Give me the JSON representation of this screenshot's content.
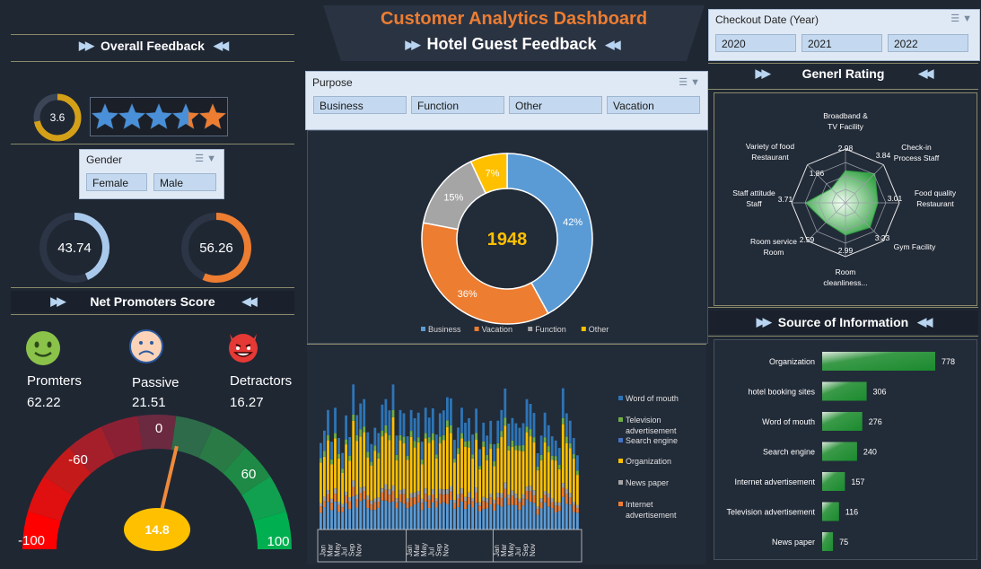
{
  "title": {
    "main": "Customer Analytics Dashboard",
    "sub": "Hotel Guest Feedback"
  },
  "overall_feedback": {
    "heading": "Overall Feedback",
    "rating": "3.6",
    "stars_filled": 3.6
  },
  "gender": {
    "title": "Gender",
    "options": [
      "Female",
      "Male"
    ],
    "female_value": "43.74",
    "male_value": "56.26"
  },
  "purpose": {
    "title": "Purpose",
    "options": [
      "Business",
      "Function",
      "Other",
      "Vacation"
    ]
  },
  "checkout": {
    "title": "Checkout Date (Year)",
    "options": [
      "2020",
      "2021",
      "2022"
    ]
  },
  "donut": {
    "center": "1948",
    "slices": [
      {
        "name": "Business",
        "pct": 42,
        "label": "42%",
        "color": "#5b9bd5"
      },
      {
        "name": "Vacation",
        "pct": 36,
        "label": "36%",
        "color": "#ed7d31"
      },
      {
        "name": "Function",
        "pct": 15,
        "label": "15%",
        "color": "#a5a5a5"
      },
      {
        "name": "Other",
        "pct": 7,
        "label": "7%",
        "color": "#ffc000"
      }
    ]
  },
  "nps": {
    "heading": "Net Promoters Score",
    "promoters": {
      "label": "Promters",
      "value": "62.22"
    },
    "passive": {
      "label": "Passive",
      "value": "21.51"
    },
    "detractors": {
      "label": "Detractors",
      "value": "16.27"
    },
    "gauge": {
      "value": "14.8",
      "labels": [
        "-100",
        "-60",
        "0",
        "60",
        "100"
      ]
    }
  },
  "rating": {
    "heading": "Generl Rating",
    "axes": [
      {
        "label": [
          "Broadband &",
          "TV Facility"
        ],
        "value": "2.98"
      },
      {
        "label": [
          "Check-in",
          "Process Staff"
        ],
        "value": "3.84"
      },
      {
        "label": [
          "Food quality",
          "Restaurant"
        ],
        "value": "3.01"
      },
      {
        "label": [
          "Gym Facility"
        ],
        "value": "3.23"
      },
      {
        "label": [
          "Room",
          "cleanliness..."
        ],
        "value": "2.99"
      },
      {
        "label": [
          "Room service",
          "Room"
        ],
        "value": "2.59"
      },
      {
        "label": [
          "Staff attitude",
          "Staff"
        ],
        "value": "3.71"
      },
      {
        "label": [
          "Variety of food",
          "Restaurant"
        ],
        "value": "1.86"
      }
    ]
  },
  "source": {
    "heading": "Source of Information",
    "items": [
      {
        "label": "Organization",
        "value": 778
      },
      {
        "label": "hotel booking sites",
        "value": 306
      },
      {
        "label": "Word of mouth",
        "value": 276
      },
      {
        "label": "Search engine",
        "value": 240
      },
      {
        "label": "Internet advertisement",
        "value": 157
      },
      {
        "label": "Television advertisement",
        "value": 116
      },
      {
        "label": "News paper",
        "value": 75
      }
    ]
  },
  "chart_data": {
    "type": "bar",
    "stacked": true,
    "legend": [
      {
        "name": "Word of mouth",
        "color": "#2e75b6"
      },
      {
        "name": "Television advertisement",
        "color": "#70ad47"
      },
      {
        "name": "Search engine",
        "color": "#4472c4"
      },
      {
        "name": "Organization",
        "color": "#ffc000"
      },
      {
        "name": "News paper",
        "color": "#a5a5a5"
      },
      {
        "name": "Internet advertisement",
        "color": "#ed7d31"
      }
    ],
    "month_labels": [
      "Jan",
      "Mar",
      "May",
      "Jul",
      "Sep",
      "Nov"
    ],
    "years": 3,
    "series_order": [
      "Search engine",
      "Internet advertisement",
      "News paper",
      "Organization",
      "Television advertisement",
      "Word of mouth"
    ],
    "colors": [
      "#5b9bd5",
      "#ed7d31",
      "#a5a5a5",
      "#ffc000",
      "#70ad47",
      "#2e75b6"
    ],
    "totals": [
      34,
      40,
      44,
      37,
      47,
      36,
      31,
      42,
      39,
      56,
      45,
      51,
      48,
      41,
      33,
      40,
      39,
      46,
      55,
      46,
      57,
      38,
      44,
      49,
      36,
      47,
      45,
      43,
      37,
      47,
      44,
      49,
      35,
      49,
      46,
      52,
      53,
      33,
      43,
      47,
      42,
      45,
      35,
      51,
      31,
      42,
      38,
      40,
      36,
      42,
      47,
      57,
      39,
      47,
      41,
      40,
      43,
      48,
      53,
      45,
      30,
      38,
      43,
      44,
      36,
      35,
      33,
      52,
      49,
      42,
      36,
      30
    ]
  }
}
